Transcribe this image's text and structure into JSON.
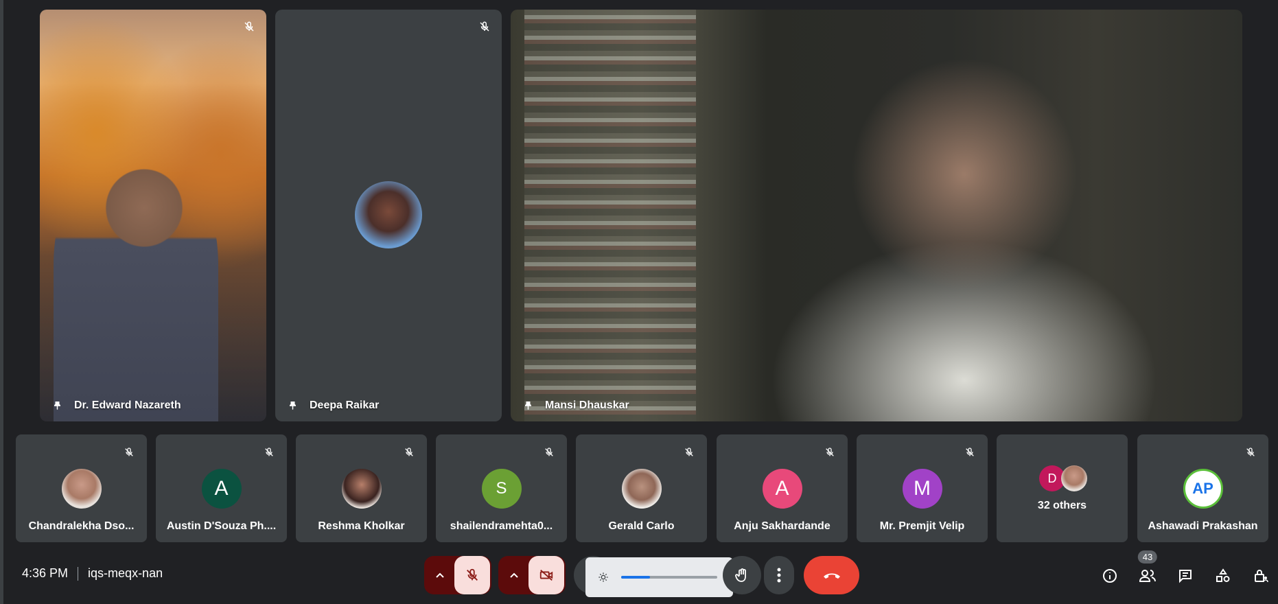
{
  "colors": {
    "background": "#202124",
    "tile": "#3c4043",
    "mic_red": "#5c0b0b",
    "mic_pink": "#f9dedc",
    "end_call": "#ea4335",
    "accent": "#1a73e8"
  },
  "main_tiles": [
    {
      "name": "Dr. Edward Nazareth",
      "muted": true
    },
    {
      "name": "Deepa Raikar",
      "muted": true
    },
    {
      "name": "Mansi Dhauskar",
      "muted": false
    }
  ],
  "filmstrip": [
    {
      "label": "Chandralekha Dso...",
      "avatar": "",
      "avatar_color": "#e8e2dd",
      "kind": "photo"
    },
    {
      "label": "Austin D'Souza Ph....",
      "avatar": "A",
      "avatar_color": "#0b5240",
      "kind": "letter"
    },
    {
      "label": "Reshma Kholkar",
      "avatar": "",
      "avatar_color": "#e8e2dd",
      "kind": "photo"
    },
    {
      "label": "shailendramehta0...",
      "avatar": "S",
      "avatar_color": "#6ba034",
      "kind": "letter"
    },
    {
      "label": "Gerald Carlo",
      "avatar": "",
      "avatar_color": "#e8e2dd",
      "kind": "photo"
    },
    {
      "label": "Anju Sakhardande",
      "avatar": "A",
      "avatar_color": "#e8497a",
      "kind": "letter"
    },
    {
      "label": "Mr. Premjit Velip",
      "avatar": "M",
      "avatar_color": "#a142c7",
      "kind": "letter"
    },
    {
      "label": "32 others",
      "avatar": "D",
      "avatar_color": "#c2185b",
      "kind": "others"
    },
    {
      "label": "Ashawadi Prakashan",
      "avatar": "AP",
      "avatar_color": "#ffffff",
      "kind": "logo"
    }
  ],
  "bottom_bar": {
    "time": "4:36 PM",
    "meeting_code": "iqs-meqx-nan",
    "people_count": "43",
    "brightness_level": 0.3
  }
}
